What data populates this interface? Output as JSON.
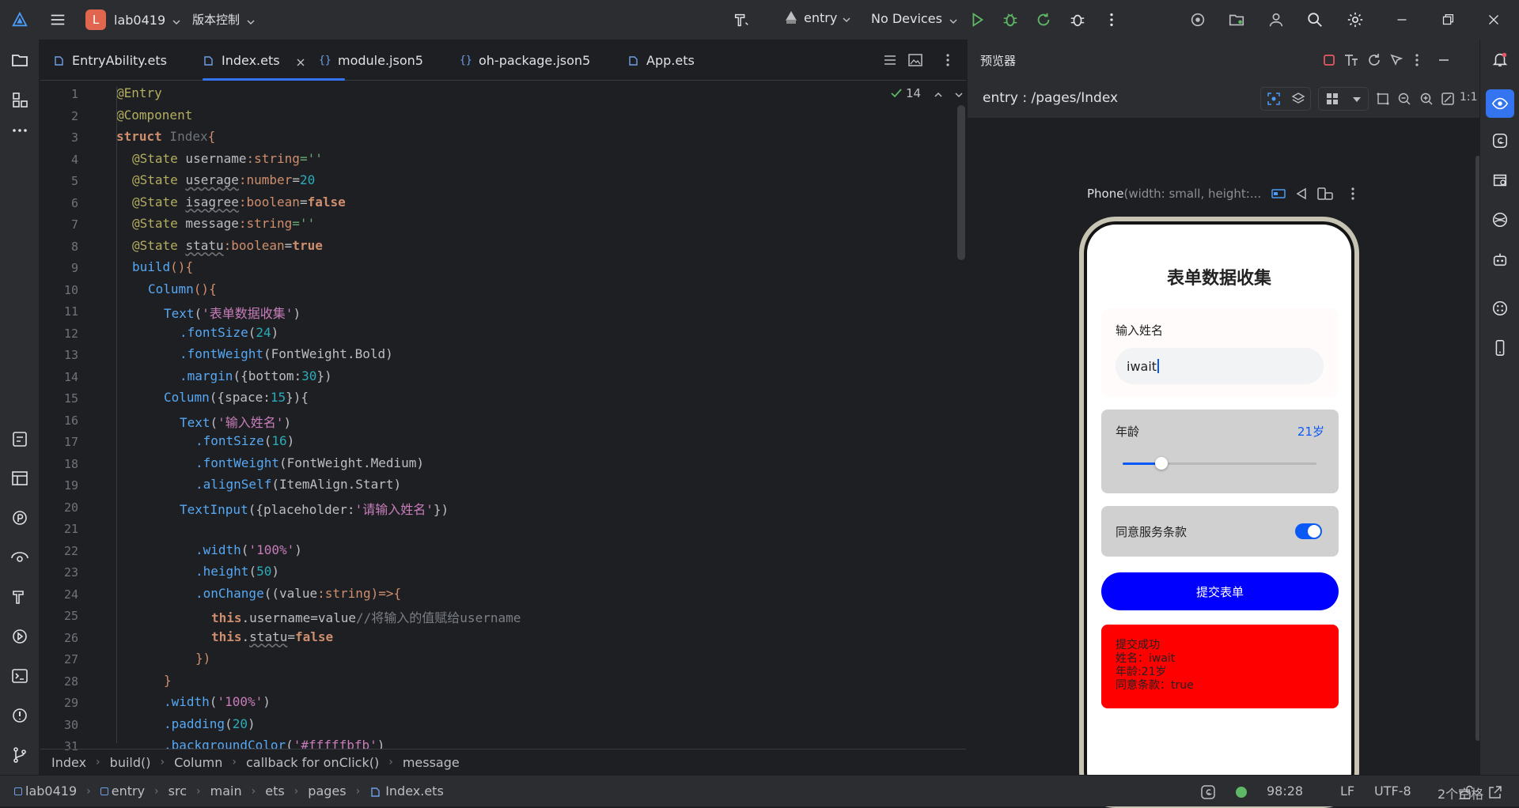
{
  "title_bar": {
    "project_badge": "L",
    "project_name": "lab0419",
    "vcs_menu": "版本控制",
    "run_config": "entry",
    "device": "No Devices",
    "colors": {
      "badge": "#e0664f",
      "run": "#5fb865",
      "debug": "#5fb865"
    }
  },
  "editor": {
    "tabs": [
      {
        "label": "EntryAbility.ets",
        "icon": "ets-file-icon",
        "active": false
      },
      {
        "label": "Index.ets",
        "icon": "ets-file-icon",
        "active": true
      },
      {
        "label": "module.json5",
        "icon": "json-file-icon",
        "active": false
      },
      {
        "label": "oh-package.json5",
        "icon": "json-file-icon",
        "active": false
      },
      {
        "label": "App.ets",
        "icon": "ets-file-icon",
        "active": false
      }
    ],
    "inspection_count": "14",
    "line_numbers": [
      "1",
      "2",
      "3",
      "4",
      "5",
      "6",
      "7",
      "8",
      "9",
      "10",
      "11",
      "12",
      "13",
      "14",
      "15",
      "16",
      "17",
      "18",
      "19",
      "20",
      "21",
      "22",
      "23",
      "24",
      "25",
      "26",
      "27",
      "28",
      "29",
      "30",
      "31"
    ],
    "breadcrumb": [
      "Index",
      "build()",
      "Column",
      "callback for onClick()",
      "message"
    ]
  },
  "code": {
    "l1": "@Entry",
    "l2": "@Component",
    "l3_kw": "struct",
    "l3_name": " Index",
    "l3_rest": "{",
    "l4_dec": "@State",
    "l4_var": " username",
    "l4_type": ":string",
    "l4_val": "=''",
    "l5_dec": "@State",
    "l5_var": "userage",
    "l5_type": ":number",
    "l5_val": "20",
    "l6_dec": "@State",
    "l6_var": "isagree",
    "l6_type": ":boolean",
    "l6_val": "false",
    "l7_dec": "@State",
    "l7_var": " message",
    "l7_type": ":string",
    "l7_val": "=''",
    "l8_dec": "@State",
    "l8_var": "statu",
    "l8_type": ":boolean",
    "l8_val": "true",
    "l9_fn": "build",
    "l9_rest": "(){",
    "l10_fn": "Column",
    "l10_rest": "(){",
    "l11_fn": "Text",
    "l11_str": "'表单数据收集'",
    "l12_fn": ".fontSize",
    "l12_num": "24",
    "l13_fn": ".fontWeight",
    "l13_arg": "FontWeight.Bold",
    "l14_fn": ".margin",
    "l14_key": "bottom:",
    "l14_num": "30",
    "l15_fn": "Column",
    "l15_key": "space:",
    "l15_num": "15",
    "l16_fn": "Text",
    "l16_str": "'输入姓名'",
    "l17_fn": ".fontSize",
    "l17_num": "16",
    "l18_fn": ".fontWeight",
    "l18_arg": "FontWeight.Medium",
    "l19_fn": ".alignSelf",
    "l19_arg": "ItemAlign.Start",
    "l20_fn": "TextInput",
    "l20_key": "placeholder:",
    "l20_str": "'请输入姓名'",
    "l22_fn": ".width",
    "l22_str": "'100%'",
    "l23_fn": ".height",
    "l23_num": "50",
    "l24_fn": ".onChange",
    "l24_arg": "value",
    "l24_type": ":string",
    "l24_rest": ")=>{",
    "l25_kw": "this",
    "l25_mid": ".username=value",
    "l25_cm": "//将输入的值赋给username",
    "l26_kw": "this",
    "l26_mid": ".",
    "l26_var": "statu",
    "l26_val": "false",
    "l27": "})",
    "l28": "}",
    "l29_fn": ".width",
    "l29_str": "'100%'",
    "l30_fn": ".padding",
    "l30_num": "20",
    "l31_fn": ".backgroundColor",
    "l31_str": "'#fffffbfb'"
  },
  "preview": {
    "panel_title": "预览器",
    "path": "entry : /pages/Index",
    "device_label": "Phone",
    "device_detail": " (width: small, height:...",
    "scale_label": "1:1",
    "app": {
      "title": "表单数据收集",
      "name_label": "输入姓名",
      "name_value": "iwait",
      "age_label": "年龄",
      "age_value": "21岁",
      "slider_fraction": 0.2,
      "agree_label": "同意服务条款",
      "agree_on": true,
      "submit_label": "提交表单",
      "result_lines": [
        "提交成功",
        "姓名：iwait",
        "年龄:21岁",
        "同意条款：true"
      ],
      "colors": {
        "submit": "#0000ff",
        "result": "#ff0000",
        "card": "#d0d0d0",
        "name_card": "#fffbfb",
        "accent": "#0a59f7"
      }
    }
  },
  "status_bar": {
    "path": [
      "lab0419",
      "entry",
      "src",
      "main",
      "ets",
      "pages",
      "Index.ets"
    ],
    "cursor": "98:28",
    "line_ending": "LF",
    "encoding": "UTF-8",
    "indent": "2个空格"
  }
}
